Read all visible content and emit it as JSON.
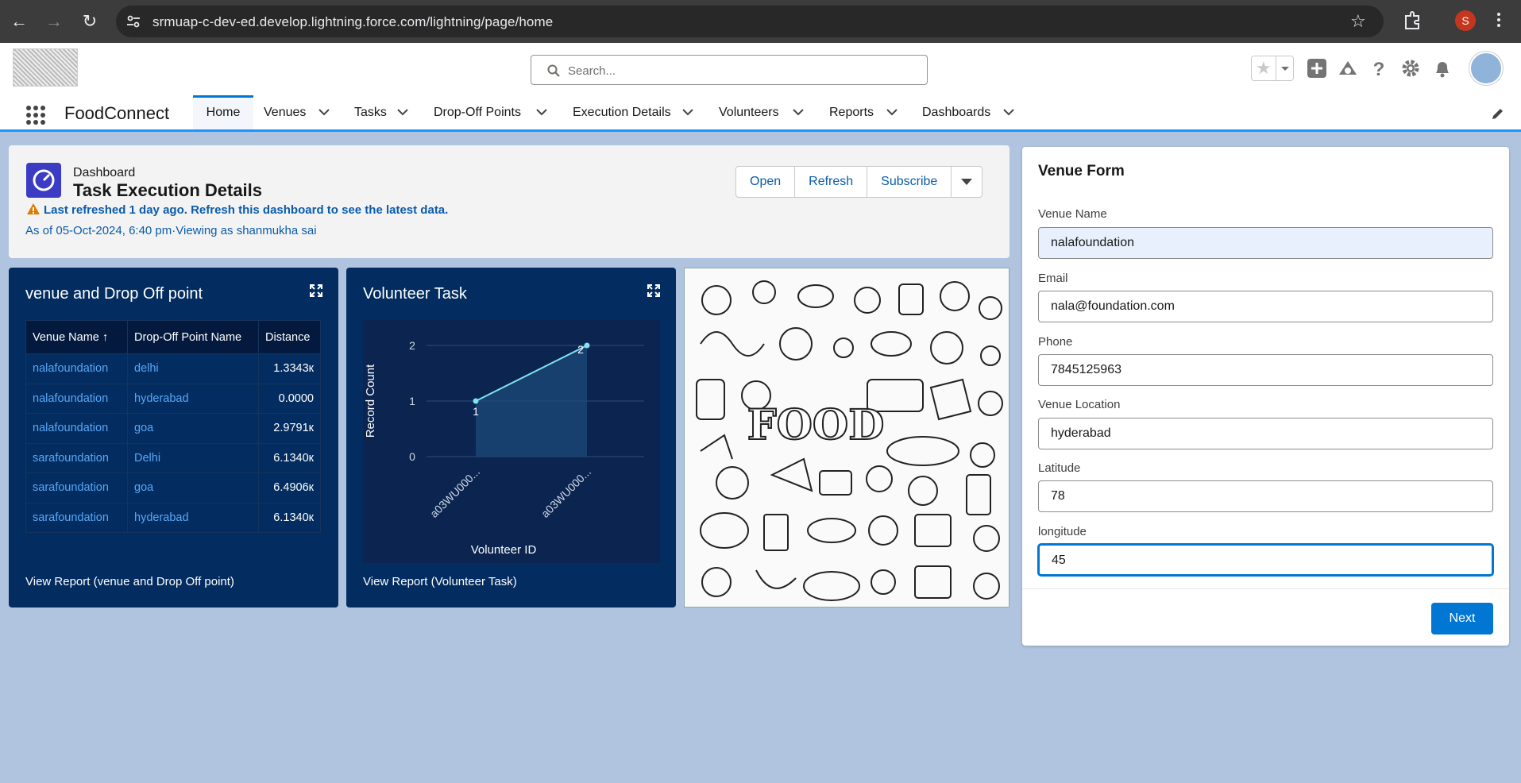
{
  "browser": {
    "url": "srmuap-c-dev-ed.develop.lightning.force.com/lightning/page/home",
    "profile_initial": "S"
  },
  "header": {
    "search_placeholder": "Search..."
  },
  "nav": {
    "app_name": "FoodConnect",
    "items": [
      {
        "label": "Home"
      },
      {
        "label": "Venues"
      },
      {
        "label": "Tasks"
      },
      {
        "label": "Drop-Off Points"
      },
      {
        "label": "Execution Details"
      },
      {
        "label": "Volunteers"
      },
      {
        "label": "Reports"
      },
      {
        "label": "Dashboards"
      }
    ]
  },
  "dashboard": {
    "label": "Dashboard",
    "title": "Task Execution Details",
    "warning": "Last refreshed 1 day ago. Refresh this dashboard to see the latest data.",
    "as_of": "As of 05-Oct-2024, 6:40 pm·Viewing as shanmukha sai",
    "buttons": {
      "open": "Open",
      "refresh": "Refresh",
      "subscribe": "Subscribe"
    }
  },
  "venue_table": {
    "title": "venue and Drop Off point",
    "headers": [
      "Venue Name ↑",
      "Drop-Off Point Name",
      "Distance"
    ],
    "rows": [
      [
        "nalafoundation",
        "delhi",
        "1.3343к"
      ],
      [
        "nalafoundation",
        "hyderabad",
        "0.0000"
      ],
      [
        "nalafoundation",
        "goa",
        "2.9791к"
      ],
      [
        "sarafoundation",
        "Delhi",
        "6.1340к"
      ],
      [
        "sarafoundation",
        "goa",
        "6.4906к"
      ],
      [
        "sarafoundation",
        "hyderabad",
        "6.1340к"
      ]
    ],
    "view_report": "View Report (venue and Drop Off point)"
  },
  "volunteer_chart": {
    "view_report": "View Report (Volunteer Task)"
  },
  "chart_data": {
    "type": "line",
    "title": "Volunteer Task",
    "xlabel": "Volunteer ID",
    "ylabel": "Record Count",
    "categories": [
      "a03WU000...",
      "a03WU000..."
    ],
    "values": [
      1,
      2
    ],
    "ylim": [
      0,
      2
    ],
    "yticks": [
      0,
      1,
      2
    ],
    "grid": true,
    "line_color": "#7fe3f0"
  },
  "food_image": {
    "caption": "FOOD"
  },
  "venue_form": {
    "title": "Venue Form",
    "fields": [
      {
        "label": "Venue Name",
        "value": "nalafoundation"
      },
      {
        "label": "Email",
        "value": "nala@foundation.com"
      },
      {
        "label": "Phone",
        "value": "7845125963"
      },
      {
        "label": "Venue Location",
        "value": "hyderabad"
      },
      {
        "label": "Latitude",
        "value": "78"
      },
      {
        "label": "longitude",
        "value": "45"
      }
    ],
    "next_label": "Next"
  },
  "colors": {
    "brand_blue": "#0176d3",
    "dashboard_card": "#032d60",
    "link": "#58a6f5"
  }
}
